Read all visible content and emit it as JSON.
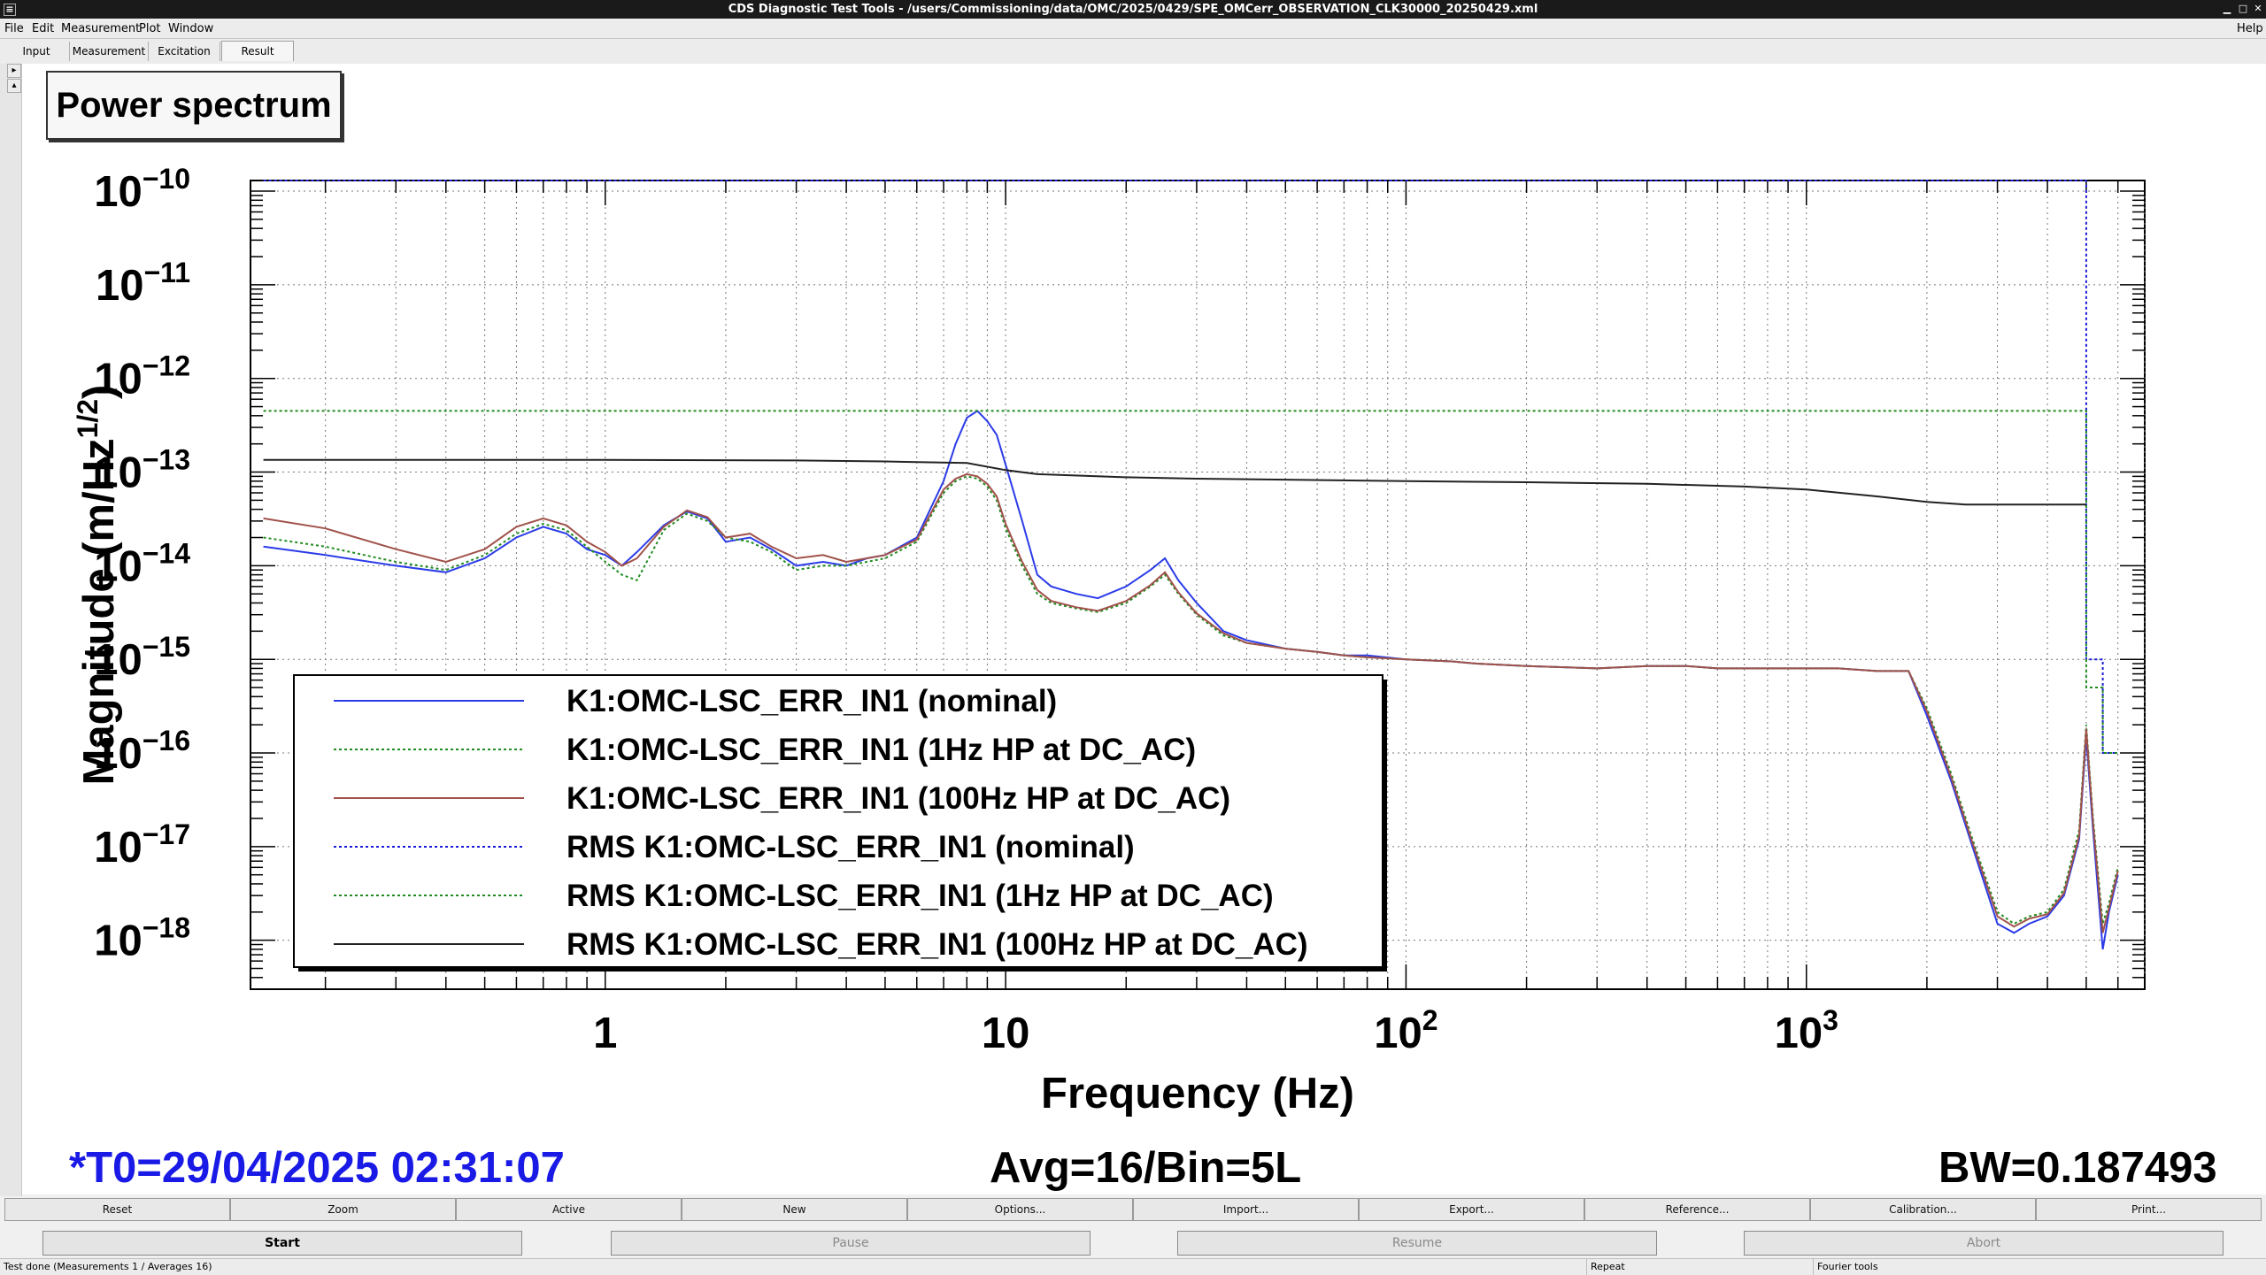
{
  "window": {
    "title": "CDS Diagnostic Test Tools - /users/Commissioning/data/OMC/2025/0429/SPE_OMCerr_OBSERVATION_CLK30000_20250429.xml"
  },
  "menu": {
    "file": "File",
    "edit": "Edit",
    "measurement": "Measurement",
    "plot": "Plot",
    "window": "Window",
    "help": "Help"
  },
  "tabs": {
    "input": "Input",
    "measurement": "Measurement",
    "excitation": "Excitation",
    "result": "Result",
    "active": "Result"
  },
  "plot": {
    "title": "Power spectrum",
    "t0": "*T0=29/04/2025 02:31:07",
    "avg": "Avg=16/Bin=5L",
    "bw": "BW=0.187493"
  },
  "chart_data": {
    "type": "line",
    "xlabel": "Frequency (Hz)",
    "ylabel": "Magnitude (m/Hz",
    "ylabel_sup": "1/2",
    "ylabel_end": ")",
    "xscale": "log",
    "yscale": "log",
    "xlim": [
      0.13,
      7000
    ],
    "ylim": [
      3e-19,
      1.3e-10
    ],
    "grid": true,
    "legend_position": "bottom-left",
    "x_tick_labels": [
      {
        "value": 1,
        "base": "1",
        "exp": ""
      },
      {
        "value": 10,
        "base": "10",
        "exp": ""
      },
      {
        "value": 100,
        "base": "10",
        "exp": "2"
      },
      {
        "value": 1000,
        "base": "10",
        "exp": "3"
      }
    ],
    "y_tick_labels": [
      {
        "value": 1e-10,
        "base": "10",
        "exp": "−10"
      },
      {
        "value": 1e-11,
        "base": "10",
        "exp": "−11"
      },
      {
        "value": 1e-12,
        "base": "10",
        "exp": "−12"
      },
      {
        "value": 1e-13,
        "base": "10",
        "exp": "−13"
      },
      {
        "value": 1e-14,
        "base": "10",
        "exp": "−14"
      },
      {
        "value": 1e-15,
        "base": "10",
        "exp": "−15"
      },
      {
        "value": 1e-16,
        "base": "10",
        "exp": "−16"
      },
      {
        "value": 1e-17,
        "base": "10",
        "exp": "−17"
      },
      {
        "value": 1e-18,
        "base": "10",
        "exp": "−18"
      }
    ],
    "series": [
      {
        "name": "K1:OMC-LSC_ERR_IN1 (nominal)",
        "color": "#2b3be8",
        "style": "solid",
        "x": [
          0.14,
          0.2,
          0.3,
          0.4,
          0.5,
          0.6,
          0.7,
          0.8,
          0.9,
          1.0,
          1.1,
          1.2,
          1.4,
          1.6,
          1.8,
          2.0,
          2.3,
          2.6,
          3.0,
          3.5,
          4.0,
          4.5,
          5,
          6,
          7,
          7.5,
          8,
          8.5,
          9,
          9.5,
          10,
          11,
          12,
          13,
          15,
          17,
          20,
          23,
          25,
          27,
          30,
          35,
          40,
          50,
          60,
          70,
          80,
          100,
          130,
          150,
          200,
          300,
          400,
          500,
          600,
          800,
          1000,
          1200,
          1500,
          1800,
          2000,
          2300,
          2600,
          3000,
          3300,
          3600,
          4000,
          4400,
          4800,
          5000,
          5200,
          5500,
          5700,
          6000
        ],
        "y": [
          1.6e-14,
          1.3e-14,
          1e-14,
          8.5e-15,
          1.2e-14,
          2e-14,
          2.6e-14,
          2.2e-14,
          1.5e-14,
          1.3e-14,
          1e-14,
          1.4e-14,
          2.7e-14,
          3.8e-14,
          3.2e-14,
          1.8e-14,
          2e-14,
          1.5e-14,
          1e-14,
          1.1e-14,
          1e-14,
          1.2e-14,
          1.3e-14,
          2e-14,
          8e-14,
          2e-13,
          3.8e-13,
          4.5e-13,
          3.5e-13,
          2.5e-13,
          1.2e-13,
          3e-14,
          8e-15,
          6e-15,
          5e-15,
          4.5e-15,
          6e-15,
          9e-15,
          1.2e-14,
          7e-15,
          4e-15,
          2e-15,
          1.6e-15,
          1.3e-15,
          1.2e-15,
          1.1e-15,
          1.1e-15,
          1e-15,
          9.5e-16,
          9e-16,
          8.5e-16,
          8e-16,
          8.5e-16,
          8.5e-16,
          8e-16,
          8e-16,
          8e-16,
          8e-16,
          7.5e-16,
          7.5e-16,
          2.5e-16,
          5e-17,
          1e-17,
          1.5e-18,
          1.2e-18,
          1.5e-18,
          1.8e-18,
          3e-18,
          1.2e-17,
          1.5e-16,
          1.5e-17,
          8e-19,
          2e-18,
          5e-18
        ]
      },
      {
        "name": "K1:OMC-LSC_ERR_IN1 (1Hz HP at DC_AC)",
        "color": "#1f8c1f",
        "style": "dotted",
        "x": [
          0.14,
          0.2,
          0.3,
          0.4,
          0.5,
          0.6,
          0.7,
          0.8,
          0.9,
          1.0,
          1.1,
          1.2,
          1.4,
          1.6,
          1.8,
          2.0,
          2.3,
          2.6,
          3.0,
          3.5,
          4.0,
          4.5,
          5,
          6,
          7,
          7.5,
          8,
          8.5,
          9,
          9.5,
          10,
          11,
          12,
          13,
          15,
          17,
          20,
          23,
          25,
          27,
          30,
          35,
          40,
          50,
          60,
          70,
          80,
          100,
          130,
          150,
          200,
          300,
          400,
          500,
          600,
          800,
          1000,
          1200,
          1500,
          1800,
          2000,
          2300,
          2600,
          3000,
          3300,
          3600,
          4000,
          4400,
          4800,
          5000,
          5200,
          5500,
          5700,
          6000
        ],
        "y": [
          2e-14,
          1.6e-14,
          1.1e-14,
          9e-15,
          1.3e-14,
          2.2e-14,
          2.8e-14,
          2.4e-14,
          1.6e-14,
          1.1e-14,
          8e-15,
          7e-15,
          2.4e-14,
          3.6e-14,
          3e-14,
          2e-14,
          1.8e-14,
          1.4e-14,
          9e-15,
          1e-14,
          1e-14,
          1.1e-14,
          1.2e-14,
          1.8e-14,
          6e-14,
          8e-14,
          9e-14,
          8.5e-14,
          7e-14,
          5e-14,
          2.5e-14,
          1e-14,
          5e-15,
          4e-15,
          3.5e-15,
          3.2e-15,
          4e-15,
          6e-15,
          8e-15,
          5e-15,
          3e-15,
          1.8e-15,
          1.5e-15,
          1.3e-15,
          1.2e-15,
          1.1e-15,
          1.05e-15,
          1e-15,
          9.5e-16,
          9e-16,
          8.5e-16,
          8e-16,
          8.5e-16,
          8.5e-16,
          8e-16,
          8e-16,
          8e-16,
          8e-16,
          7.5e-16,
          7.5e-16,
          3e-16,
          6e-17,
          1.2e-17,
          2e-18,
          1.5e-18,
          1.8e-18,
          2e-18,
          3.5e-18,
          1.5e-17,
          2e-16,
          2e-17,
          1.5e-18,
          2.5e-18,
          6e-18
        ]
      },
      {
        "name": "K1:OMC-LSC_ERR_IN1 (100Hz HP at DC_AC)",
        "color": "#a0524a",
        "style": "solid",
        "x": [
          0.14,
          0.2,
          0.3,
          0.4,
          0.5,
          0.6,
          0.7,
          0.8,
          0.9,
          1.0,
          1.1,
          1.2,
          1.4,
          1.6,
          1.8,
          2.0,
          2.3,
          2.6,
          3.0,
          3.5,
          4.0,
          4.5,
          5,
          6,
          7,
          7.5,
          8,
          8.5,
          9,
          9.5,
          10,
          11,
          12,
          13,
          15,
          17,
          20,
          23,
          25,
          27,
          30,
          35,
          40,
          50,
          60,
          70,
          80,
          100,
          130,
          150,
          200,
          300,
          400,
          500,
          600,
          800,
          1000,
          1200,
          1500,
          1800,
          2000,
          2300,
          2600,
          3000,
          3300,
          3600,
          4000,
          4400,
          4800,
          5000,
          5200,
          5500,
          5700,
          6000
        ],
        "y": [
          3.2e-14,
          2.5e-14,
          1.5e-14,
          1.1e-14,
          1.5e-14,
          2.6e-14,
          3.2e-14,
          2.7e-14,
          1.8e-14,
          1.4e-14,
          1e-14,
          1.2e-14,
          2.6e-14,
          3.9e-14,
          3.3e-14,
          2e-14,
          2.2e-14,
          1.6e-14,
          1.2e-14,
          1.3e-14,
          1.1e-14,
          1.2e-14,
          1.3e-14,
          1.9e-14,
          6.5e-14,
          8.5e-14,
          9.5e-14,
          9e-14,
          7.5e-14,
          5.5e-14,
          2.8e-14,
          1.1e-14,
          5.5e-15,
          4.2e-15,
          3.6e-15,
          3.3e-15,
          4.2e-15,
          6.2e-15,
          8.5e-15,
          5.2e-15,
          3.1e-15,
          1.9e-15,
          1.5e-15,
          1.3e-15,
          1.2e-15,
          1.1e-15,
          1.05e-15,
          1e-15,
          9.5e-16,
          9e-16,
          8.5e-16,
          8e-16,
          8.5e-16,
          8.5e-16,
          8e-16,
          8e-16,
          8e-16,
          8e-16,
          7.5e-16,
          7.5e-16,
          2.8e-16,
          5.5e-17,
          1.1e-17,
          1.8e-18,
          1.4e-18,
          1.7e-18,
          1.9e-18,
          3.2e-18,
          1.3e-17,
          1.8e-16,
          1.8e-17,
          1.2e-18,
          2.2e-18,
          5.5e-18
        ]
      },
      {
        "name": "RMS K1:OMC-LSC_ERR_IN1 (nominal)",
        "color": "#1c1cd6",
        "style": "dotted",
        "x": [
          0.14,
          5000,
          5000,
          5001,
          5500,
          5500,
          6000
        ],
        "y": [
          1.3e-10,
          1.3e-10,
          1e-15,
          1e-15,
          1e-15,
          1e-16,
          1e-16
        ]
      },
      {
        "name": "RMS K1:OMC-LSC_ERR_IN1 (1Hz HP at DC_AC)",
        "color": "#1f8c1f",
        "style": "dotted",
        "x": [
          0.14,
          5000,
          5000,
          5001,
          5500,
          5500,
          6000
        ],
        "y": [
          4.5e-13,
          4.5e-13,
          5e-16,
          5e-16,
          5e-16,
          1e-16,
          1e-16
        ]
      },
      {
        "name": "RMS K1:OMC-LSC_ERR_IN1 (100Hz HP at DC_AC)",
        "color": "#222222",
        "style": "solid",
        "x": [
          0.14,
          1,
          3,
          5,
          8,
          10,
          12,
          20,
          30,
          50,
          100,
          200,
          400,
          700,
          1000,
          1500,
          2000,
          2500,
          5000
        ],
        "y": [
          1.35e-13,
          1.35e-13,
          1.33e-13,
          1.3e-13,
          1.25e-13,
          1.05e-13,
          9.5e-14,
          8.8e-14,
          8.5e-14,
          8.3e-14,
          8e-14,
          7.8e-14,
          7.5e-14,
          7e-14,
          6.5e-14,
          5.5e-14,
          4.8e-14,
          4.5e-14,
          4.5e-14
        ]
      }
    ]
  },
  "buttons_row1": [
    "Reset",
    "Zoom",
    "Active",
    "New",
    "Options...",
    "Import...",
    "Export...",
    "Reference...",
    "Calibration...",
    "Print..."
  ],
  "buttons_row2": [
    "Start",
    "Pause",
    "Resume",
    "Abort"
  ],
  "status": {
    "left": "Test done (Measurements 1 / Averages 16)",
    "repeat": "Repeat",
    "fourier": "Fourier tools"
  }
}
